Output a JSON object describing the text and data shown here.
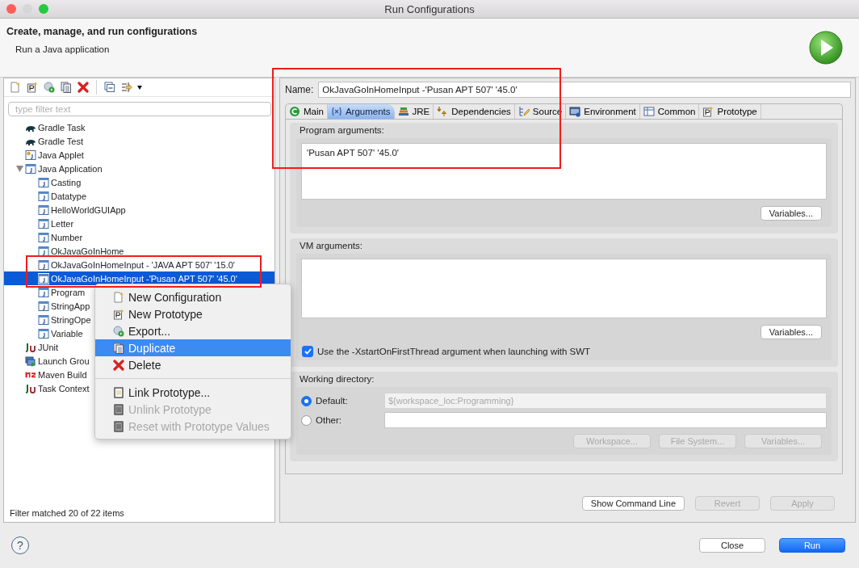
{
  "window": {
    "title": "Run Configurations"
  },
  "header": {
    "title": "Create, manage, and run configurations",
    "subtitle": "Run a Java application"
  },
  "filter": {
    "placeholder": "type filter text"
  },
  "tree": [
    {
      "label": "Gradle Task",
      "kind": "gradle",
      "selected": false
    },
    {
      "label": "Gradle Test",
      "kind": "gradle",
      "selected": false
    },
    {
      "label": "Java Applet",
      "kind": "applet",
      "selected": false
    },
    {
      "label": "Java Application",
      "kind": "java",
      "selected": false,
      "expanded": true,
      "children": [
        {
          "label": "Casting",
          "kind": "java",
          "selected": false
        },
        {
          "label": "Datatype",
          "kind": "java",
          "selected": false
        },
        {
          "label": "HelloWorldGUIApp",
          "kind": "java",
          "selected": false
        },
        {
          "label": "Letter",
          "kind": "java",
          "selected": false
        },
        {
          "label": "Number",
          "kind": "java",
          "selected": false
        },
        {
          "label": "OkJavaGoInHome",
          "kind": "java",
          "selected": false
        },
        {
          "label": "OkJavaGoInHomeInput - 'JAVA APT 507' '15.0'",
          "kind": "java",
          "selected": false
        },
        {
          "label": "OkJavaGoInHomeInput -'Pusan APT 507' '45.0'",
          "kind": "java",
          "selected": true
        },
        {
          "label": "Program",
          "kind": "java",
          "selected": false
        },
        {
          "label": "StringApp",
          "kind": "java",
          "selected": false
        },
        {
          "label": "StringOpe",
          "kind": "java",
          "selected": false
        },
        {
          "label": "Variable",
          "kind": "java",
          "selected": false
        }
      ]
    },
    {
      "label": "JUnit",
      "kind": "junit",
      "selected": false
    },
    {
      "label": "Launch Grou",
      "kind": "launch",
      "selected": false
    },
    {
      "label": "Maven Build",
      "kind": "maven",
      "selected": false
    },
    {
      "label": "Task Context",
      "kind": "junit",
      "selected": false
    }
  ],
  "filter_status": "Filter matched 20 of 22 items",
  "context_menu": [
    {
      "kind": "item",
      "label": "New Configuration",
      "disabled": false,
      "selected": false
    },
    {
      "kind": "item",
      "label": "New Prototype",
      "disabled": false,
      "selected": false
    },
    {
      "kind": "item",
      "label": "Export...",
      "disabled": false,
      "selected": false
    },
    {
      "kind": "item",
      "label": "Duplicate",
      "disabled": false,
      "selected": true
    },
    {
      "kind": "item",
      "label": "Delete",
      "disabled": false,
      "selected": false
    },
    {
      "kind": "separator"
    },
    {
      "kind": "item",
      "label": "Link Prototype...",
      "disabled": false,
      "selected": false
    },
    {
      "kind": "item",
      "label": "Unlink Prototype",
      "disabled": true,
      "selected": false
    },
    {
      "kind": "item",
      "label": "Reset with Prototype Values",
      "disabled": true,
      "selected": false
    }
  ],
  "name": {
    "label": "Name:",
    "value": "OkJavaGoInHomeInput -'Pusan APT 507' '45.0'"
  },
  "tabs": [
    {
      "label": "Main",
      "selected": false
    },
    {
      "label": "Arguments",
      "selected": true
    },
    {
      "label": "JRE",
      "selected": false
    },
    {
      "label": "Dependencies",
      "selected": false
    },
    {
      "label": "Source",
      "selected": false
    },
    {
      "label": "Environment",
      "selected": false
    },
    {
      "label": "Common",
      "selected": false
    },
    {
      "label": "Prototype",
      "selected": false
    }
  ],
  "program_arguments": {
    "label": "Program arguments:",
    "value": "'Pusan APT 507' '45.0'",
    "button": "Variables..."
  },
  "vm_arguments": {
    "label": "VM arguments:",
    "button": "Variables...",
    "option": {
      "label": "Use the -XstartOnFirstThread argument when launching with SWT",
      "checked": true
    }
  },
  "working_directory": {
    "label": "Working directory:",
    "options": [
      {
        "label": "Default:",
        "selected": true,
        "value": "${workspace_loc:Programming}",
        "disabled": true
      },
      {
        "label": "Other:",
        "selected": false,
        "disabled": false
      }
    ],
    "buttons": [
      {
        "label": "Workspace...",
        "disabled": true
      },
      {
        "label": "File System...",
        "disabled": true
      },
      {
        "label": "Variables...",
        "disabled": true
      }
    ]
  },
  "panel_buttons": [
    {
      "label": "Show Command Line",
      "disabled": false
    },
    {
      "label": "Revert",
      "disabled": true
    },
    {
      "label": "Apply",
      "disabled": true
    }
  ],
  "help": "?",
  "dialog_buttons": [
    {
      "label": "Close",
      "kind": "normal"
    },
    {
      "label": "Run",
      "kind": "default"
    }
  ],
  "annotations": [
    {
      "kind": "rectangle"
    },
    {
      "kind": "rectangle"
    }
  ]
}
